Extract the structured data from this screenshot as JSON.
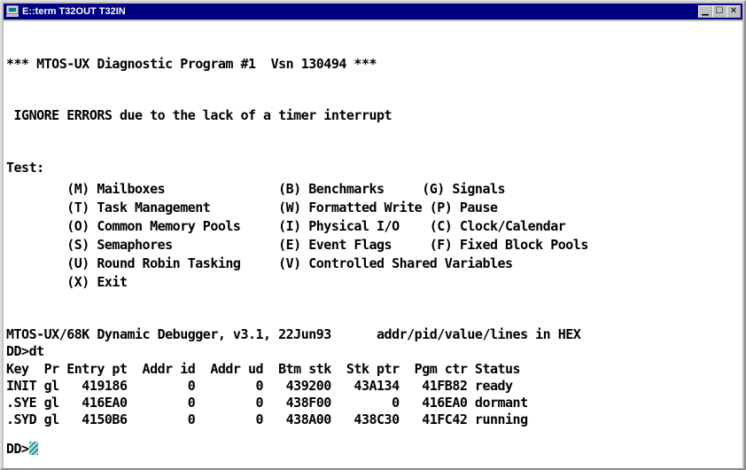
{
  "window": {
    "title": "E::term T32OUT T32IN",
    "buttons": {
      "minimize": "▁",
      "maximize": "☐",
      "close": "✕"
    }
  },
  "terminal": {
    "lines": [
      "*** MTOS-UX Diagnostic Program #1  Vsn 130494 ***",
      "",
      " IGNORE ERRORS due to the lack of a timer interrupt",
      "",
      "Test:",
      "        (M) Mailboxes               (B) Benchmarks     (G) Signals",
      "        (T) Task Management         (W) Formatted Write (P) Pause",
      "        (O) Common Memory Pools     (I) Physical I/O    (C) Clock/Calendar",
      "        (S) Semaphores              (E) Event Flags     (F) Fixed Block Pools",
      "        (U) Round Robin Tasking     (V) Controlled Shared Variables",
      "        (X) Exit",
      "",
      "",
      "MTOS-UX/68K Dynamic Debugger, v3.1, 22Jun93      addr/pid/value/lines in HEX",
      "DD>dt",
      "Key  Pr Entry pt  Addr id  Addr ud  Btm stk  Stk ptr  Pgm ctr Status",
      "INIT gl   419186        0        0   439200   43A134   41FB82 ready",
      ".SYE gl   416EA0        0        0   438F00        0   416EA0 dormant",
      ".SYD gl   4150B6        0        0   438A00   438C30   41FC42 running",
      "",
      ""
    ],
    "prompt": "DD>"
  }
}
